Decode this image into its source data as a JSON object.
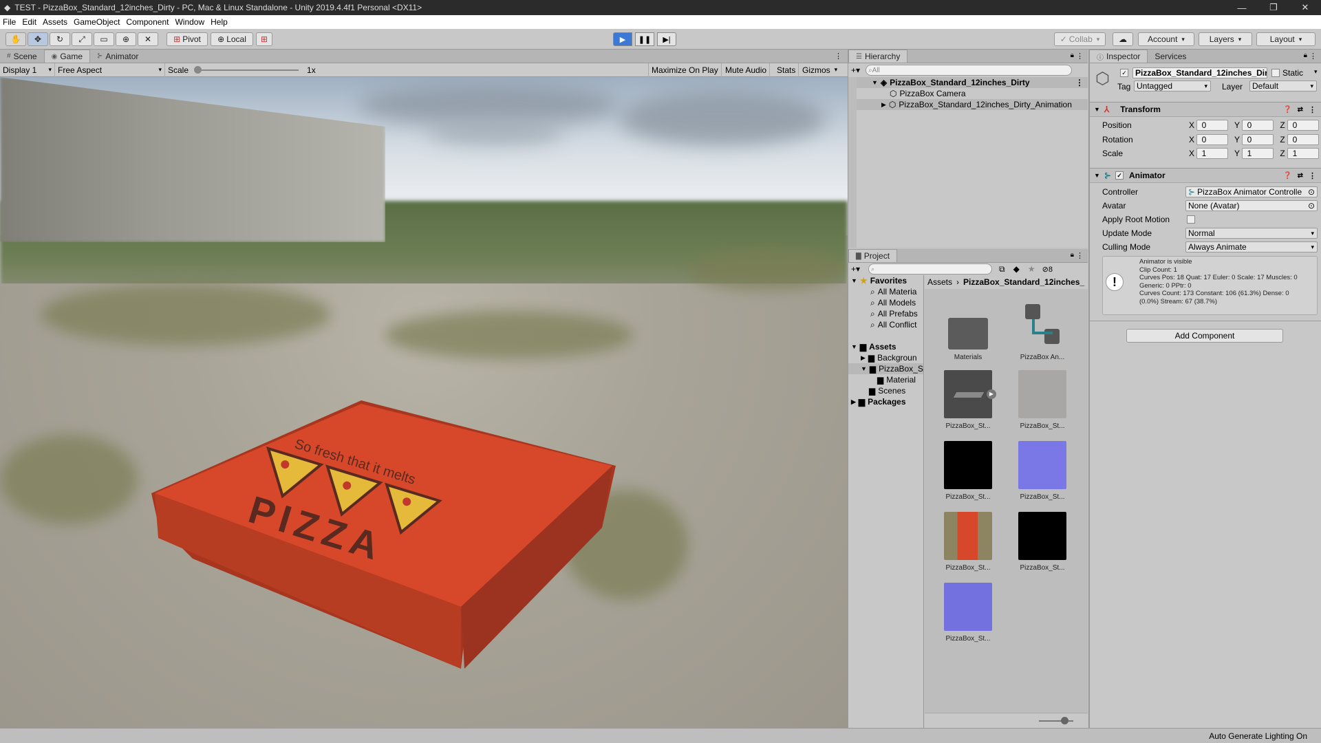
{
  "window": {
    "title": "TEST - PizzaBox_Standard_12inches_Dirty - PC, Mac & Linux Standalone - Unity 2019.4.4f1 Personal <DX11>"
  },
  "menu": [
    "File",
    "Edit",
    "Assets",
    "GameObject",
    "Component",
    "Window",
    "Help"
  ],
  "toolbar": {
    "pivot": "Pivot",
    "local": "Local",
    "collab": "Collab",
    "account": "Account",
    "layers": "Layers",
    "layout": "Layout"
  },
  "scene_tabs": {
    "scene": "Scene",
    "game": "Game",
    "animator": "Animator"
  },
  "gamebar": {
    "display": "Display 1",
    "aspect": "Free Aspect",
    "scale_label": "Scale",
    "scale_value": "1x",
    "maximize": "Maximize On Play",
    "mute": "Mute Audio",
    "stats": "Stats",
    "gizmos": "Gizmos"
  },
  "viewport": {
    "box_text_top": "So fresh that it melts",
    "box_text_main": "PIZZA"
  },
  "hierarchy": {
    "tab": "Hierarchy",
    "search_placeholder": "All",
    "items": [
      "PizzaBox_Standard_12inches_Dirty",
      "PizzaBox Camera",
      "PizzaBox_Standard_12inches_Dirty_Animation"
    ]
  },
  "project": {
    "tab": "Project",
    "hidden_count": "8",
    "tree": {
      "favorites": "Favorites",
      "fav_items": [
        "All Materia",
        "All Models",
        "All Prefabs",
        "All Conflict"
      ],
      "assets": "Assets",
      "asset_items": [
        "Backgroun",
        "PizzaBox_S",
        "Material",
        "Scenes"
      ],
      "packages": "Packages"
    },
    "breadcrumb": [
      "Assets",
      "PizzaBox_Standard_12inches_"
    ],
    "items": [
      {
        "label": "Materials",
        "kind": "folder"
      },
      {
        "label": "PizzaBox An...",
        "kind": "animator"
      },
      {
        "label": "PizzaBox_St...",
        "kind": "mesh"
      },
      {
        "label": "PizzaBox_St...",
        "kind": "gray"
      },
      {
        "label": "PizzaBox_St...",
        "kind": "black"
      },
      {
        "label": "PizzaBox_St...",
        "kind": "normal"
      },
      {
        "label": "PizzaBox_St...",
        "kind": "albedo"
      },
      {
        "label": "PizzaBox_St...",
        "kind": "black"
      },
      {
        "label": "PizzaBox_St...",
        "kind": "normal"
      }
    ]
  },
  "inspector": {
    "tabs": {
      "inspector": "Inspector",
      "services": "Services"
    },
    "object_name": "PizzaBox_Standard_12inches_Dir",
    "static": "Static",
    "tag_label": "Tag",
    "tag": "Untagged",
    "layer_label": "Layer",
    "layer": "Default",
    "transform": {
      "title": "Transform",
      "rows": [
        {
          "label": "Position",
          "x": "0",
          "y": "0",
          "z": "0"
        },
        {
          "label": "Rotation",
          "x": "0",
          "y": "0",
          "z": "0"
        },
        {
          "label": "Scale",
          "x": "1",
          "y": "1",
          "z": "1"
        }
      ]
    },
    "animator": {
      "title": "Animator",
      "controller_label": "Controller",
      "controller": "PizzaBox Animator Controlle",
      "avatar_label": "Avatar",
      "avatar": "None (Avatar)",
      "root_motion_label": "Apply Root Motion",
      "update_label": "Update Mode",
      "update": "Normal",
      "culling_label": "Culling Mode",
      "culling": "Always Animate",
      "info": [
        "Animator is visible",
        "Clip Count: 1",
        "Curves Pos: 18 Quat: 17 Euler: 0 Scale: 17 Muscles: 0",
        "Generic: 0 PPtr: 0",
        "Curves Count: 173 Constant: 106 (61.3%) Dense: 0",
        "(0.0%) Stream: 67 (38.7%)"
      ]
    },
    "add_component": "Add Component"
  },
  "status": {
    "right": "Auto Generate Lighting On"
  },
  "colors": {
    "play_active": "#3c79d6",
    "box_orange": "#d7482a",
    "box_yellow": "#e5b93a",
    "normal_map": "#7a78e6"
  }
}
